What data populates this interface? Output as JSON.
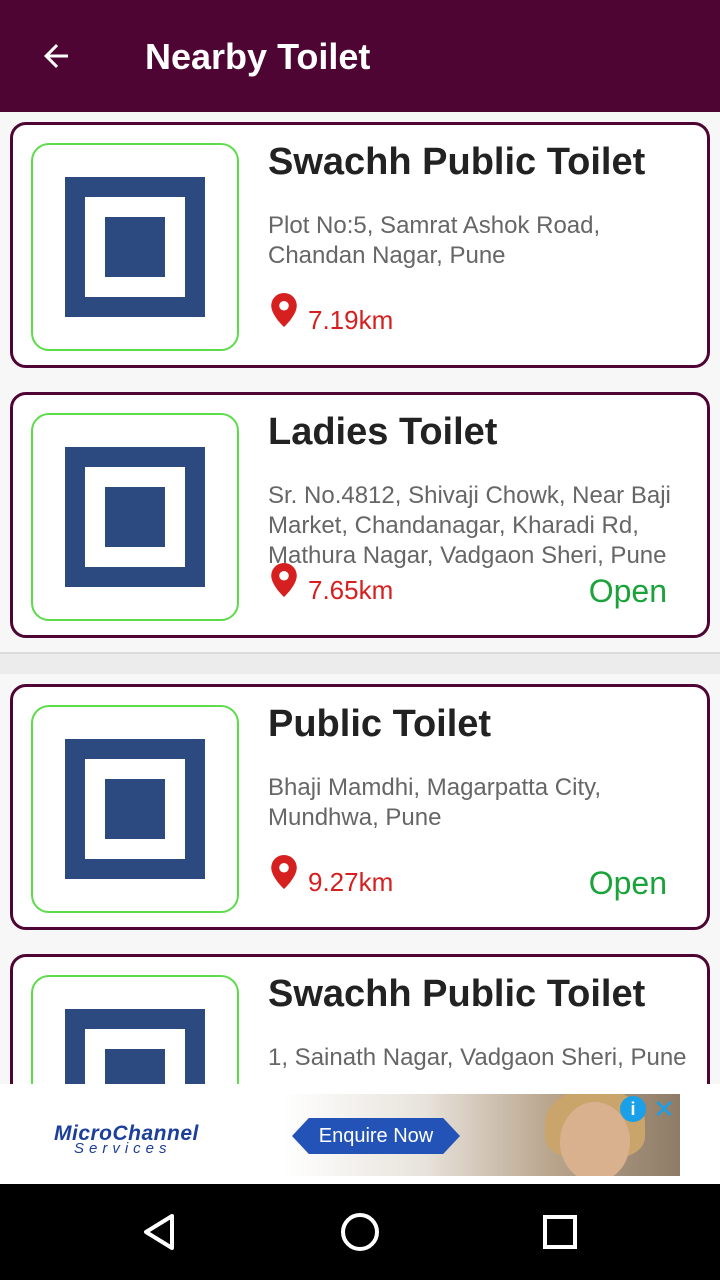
{
  "app": {
    "title": "Nearby Toilet"
  },
  "colors": {
    "appbar": "#4f0533",
    "card_border": "#4f0533",
    "thumb_border": "#5ddc4a",
    "distance": "#d6201f",
    "open": "#1aa33a"
  },
  "icons": {
    "back": "arrow-left-icon",
    "thumbnail": "toilet-placeholder-icon",
    "pin": "map-pin-icon"
  },
  "items": [
    {
      "name": "Swachh Public Toilet",
      "address": "Plot No:5, Samrat Ashok Road, Chandan Nagar, Pune",
      "distance": "7.19km",
      "status": ""
    },
    {
      "name": "Ladies Toilet",
      "address": "Sr. No.4812, Shivaji Chowk, Near Baji Market, Chandanagar, Kharadi Rd, Mathura Nagar, Vadgaon Sheri, Pune",
      "distance": "7.65km",
      "status": "Open"
    },
    {
      "name": "Public Toilet",
      "address": "Bhaji Mamdhi, Magarpatta City, Mundhwa, Pune",
      "distance": "9.27km",
      "status": "Open"
    },
    {
      "name": "Swachh Public Toilet",
      "address": "1, Sainath Nagar, Vadgaon Sheri, Pune",
      "distance": "",
      "status": ""
    }
  ],
  "ad": {
    "brand_line1": "MicroChannel",
    "brand_line2": "Services",
    "cta": "Enquire Now",
    "info_icon": "info-icon",
    "close_icon": "close-icon"
  },
  "navbar": {
    "back": "nav-back-triangle-icon",
    "home": "nav-home-circle-icon",
    "recents": "nav-recents-square-icon"
  }
}
